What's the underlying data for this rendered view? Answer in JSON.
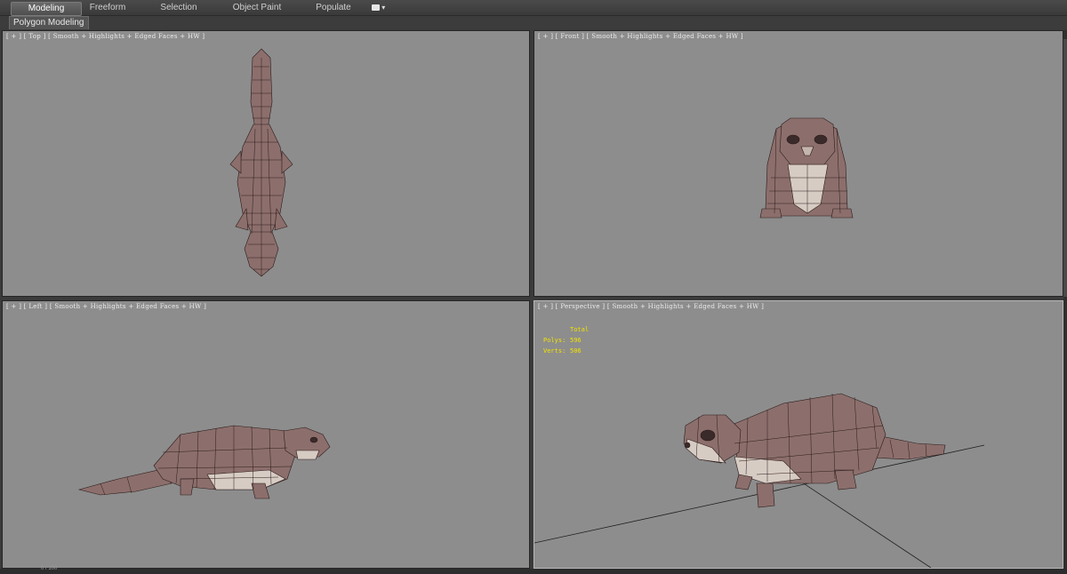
{
  "ribbon": {
    "tabs": [
      {
        "label": "Modeling",
        "active": true
      },
      {
        "label": "Freeform",
        "active": false
      },
      {
        "label": "Selection",
        "active": false
      },
      {
        "label": "Object Paint",
        "active": false
      },
      {
        "label": "Populate",
        "active": false
      }
    ],
    "extra_icon": "ribbon-options-icon",
    "panel_tab": "Polygon Modeling"
  },
  "viewports": {
    "top": {
      "label": "[ + ] [ Top ] [ Smooth + Highlights + Edged Faces + HW ]"
    },
    "front": {
      "label": "[ + ] [ Front ] [ Smooth + Highlights + Edged Faces + HW ]"
    },
    "left": {
      "label": "[ + ] [ Left ] [ Smooth + Highlights + Edged Faces + HW ]"
    },
    "perspective": {
      "label": "[ + ] [ Perspective ] [ Smooth + Highlights + Edged Faces + HW ]",
      "stats": {
        "header": "Total",
        "polys_label": "Polys:",
        "polys_value": "596",
        "verts_label": "Verts:",
        "verts_value": "506"
      }
    }
  },
  "colors": {
    "viewport_bg": "#8d8d8d",
    "model_fill": "#8c6f6c",
    "model_belly": "#d7ccc4",
    "wire": "#2a1a1a",
    "stats_text": "#f2e200"
  },
  "status": {
    "frame_counter": "0 / 100"
  }
}
